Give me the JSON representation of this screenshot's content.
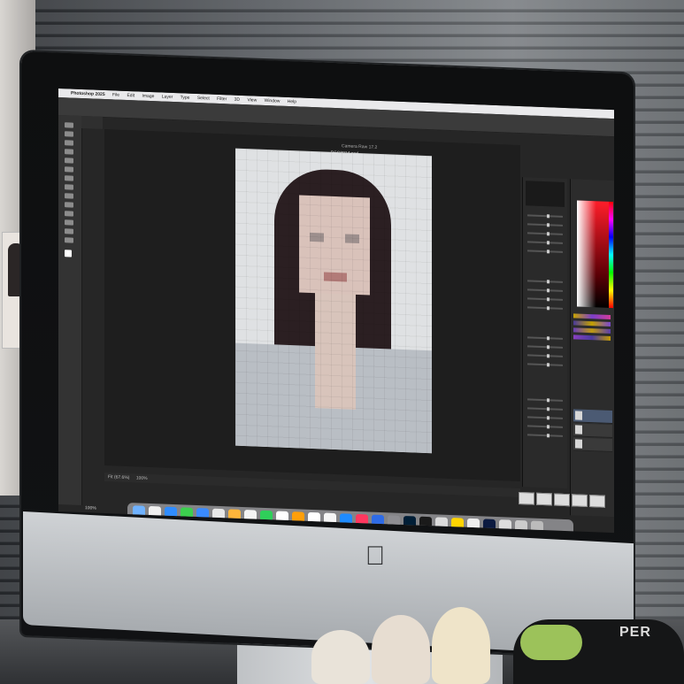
{
  "scene": {
    "description_tag": "iMac displaying Photoshop with Camera Raw over a pixelated portrait"
  },
  "menubar": {
    "app_name": "Photoshop 2025",
    "items": [
      "File",
      "Edit",
      "Image",
      "Layer",
      "Type",
      "Select",
      "Filter",
      "3D",
      "View",
      "Window",
      "Help"
    ]
  },
  "dialog": {
    "title": "Camera Raw 17.2",
    "file_name": "_DSC8914.psd"
  },
  "status": {
    "fit_zoom": "Fit (67.6%)",
    "zoom": "100%",
    "doc_zoom": "100%"
  },
  "bag_text": "PER",
  "colors": {
    "accent_red": "#ff1e2a",
    "canvas_bg": "#1e1e1e",
    "ps_panel": "#2c2c2c"
  }
}
